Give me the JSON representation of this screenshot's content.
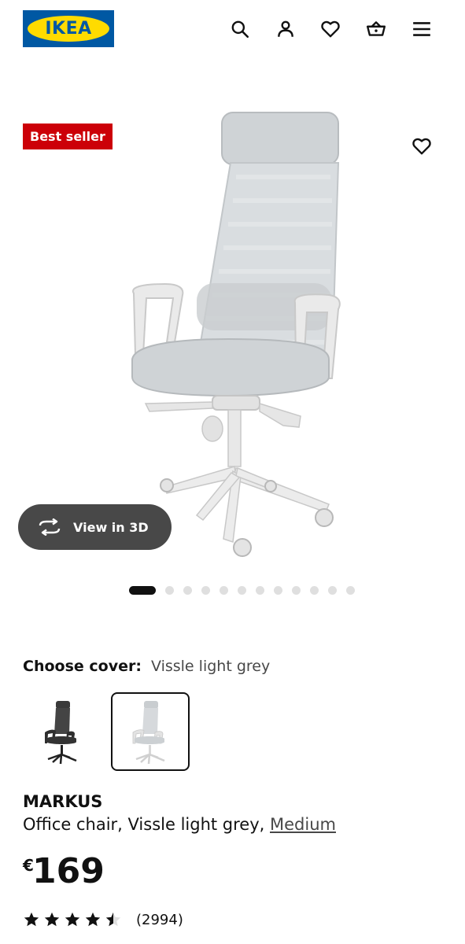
{
  "header": {
    "logo_text": "IKEA",
    "icons": [
      "search-icon",
      "account-icon",
      "favorites-icon",
      "basket-icon",
      "menu-icon"
    ]
  },
  "product_image": {
    "badge": "Best seller",
    "view_3d_label": "View in 3D",
    "gallery_dots": 12,
    "active_dot": 1
  },
  "cover": {
    "label": "Choose cover:",
    "value": "Vissle light grey",
    "options": [
      "dark grey",
      "light grey"
    ],
    "selected_index": 1
  },
  "product": {
    "name": "MARKUS",
    "description": "Office chair, Vissle light grey,",
    "size_link": "Medium",
    "currency": "€",
    "price": "169",
    "rating": 4.5,
    "rating_max": 5,
    "review_count": "(2994)"
  },
  "colors": {
    "ikea_blue": "#0058a3",
    "ikea_yellow": "#ffdb00",
    "badge_red": "#cc0008",
    "view3d_bg": "#484848"
  }
}
